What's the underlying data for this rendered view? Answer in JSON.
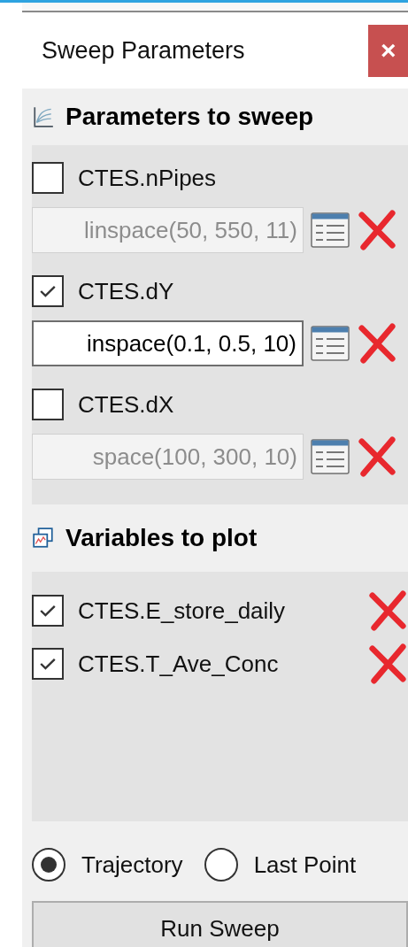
{
  "window": {
    "title": "Sweep Parameters",
    "close": "×"
  },
  "parameters": {
    "heading": "Parameters to sweep",
    "items": [
      {
        "name": "CTES.nPipes",
        "checked": false,
        "value": "linspace(50, 550, 11)"
      },
      {
        "name": "CTES.dY",
        "checked": true,
        "value": "inspace(0.1, 0.5, 10)"
      },
      {
        "name": "CTES.dX",
        "checked": false,
        "value": "space(100, 300, 10)"
      }
    ]
  },
  "variables": {
    "heading": "Variables to plot",
    "items": [
      {
        "name": "CTES.E_store_daily",
        "checked": true
      },
      {
        "name": "CTES.T_Ave_Conc",
        "checked": true
      }
    ]
  },
  "mode": [
    {
      "label": "Trajectory",
      "selected": true
    },
    {
      "label": "Last Point",
      "selected": false
    }
  ],
  "run_button": "Run Sweep"
}
